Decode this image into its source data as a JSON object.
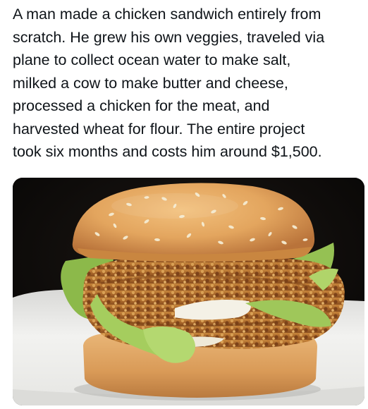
{
  "post": {
    "text": "A man made a chicken sandwich entirely from\nscratch. He grew his own veggies, traveled via\nplane to collect ocean water to make salt,\nmilked a cow to make butter and cheese,\nprocessed a chicken for the meat, and\nharvested wheat for flour. The entire project\ntook six months and costs him around $1,500."
  },
  "media": {
    "colors": {
      "background": "#0d0b0a",
      "plate": "#eeeeec",
      "bun": "#e3a55e",
      "lettuce": "#9fc75a",
      "fried_chicken": "#b5732c",
      "mayo": "#f4f1e6",
      "sesame": "#f5ecd2"
    }
  }
}
